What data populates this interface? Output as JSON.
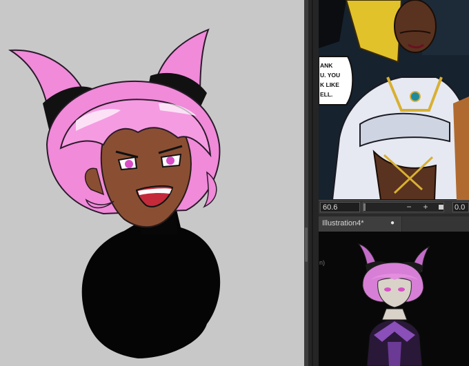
{
  "navigator": {
    "zoom_value": "60.6",
    "zoom_out_icon": "minus-icon",
    "zoom_in_icon": "plus-icon",
    "fit_icon": "square-icon",
    "angle_value": "0.0",
    "speech_bubble": [
      "ANK",
      "U. YOU",
      "K LIKE",
      "ELL."
    ]
  },
  "document_tab": {
    "title": "Illustration4*",
    "close_icon": "dot-icon"
  },
  "subview": {
    "clipped_text": "n)"
  },
  "colors": {
    "canvas_bg": "#c8c8c8",
    "panel_bg": "#353535",
    "hair_pink": "#f08ad9",
    "outfit_black": "#050505",
    "skin": "#8a4f33"
  }
}
